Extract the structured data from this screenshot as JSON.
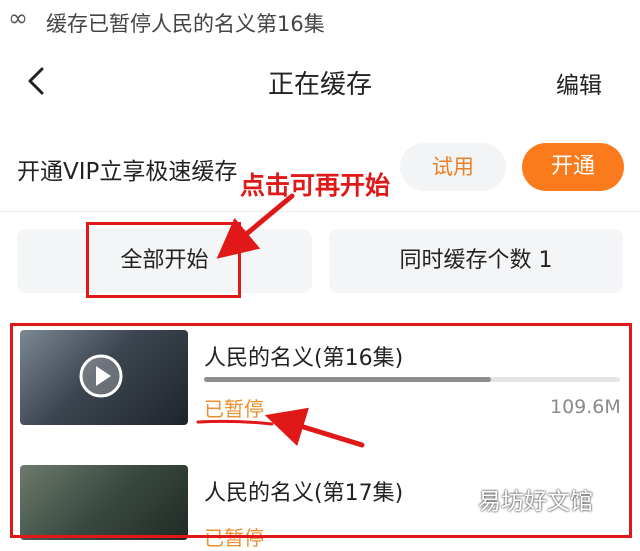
{
  "status_bar": {
    "text": "缓存已暂停人民的名义第16集"
  },
  "nav": {
    "title": "正在缓存",
    "edit_label": "编辑"
  },
  "vip": {
    "promo_text": "开通VIP立享极速缓存",
    "trial_label": "试用",
    "open_label": "开通"
  },
  "actions": {
    "start_all_label": "全部开始",
    "concurrent_label": "同时缓存个数 1"
  },
  "annotation": {
    "caption": "点击可再开始",
    "color": "#e01818"
  },
  "downloads": [
    {
      "title": "人民的名义(第16集)",
      "status": "已暂停",
      "size": "109.6M",
      "progress": 0.69
    },
    {
      "title": "人民的名义(第17集)",
      "status": "已暂停"
    }
  ],
  "watermark": "易坊好文馆",
  "colors": {
    "accent": "#fb7b1c",
    "paused_text": "#e8902e"
  }
}
